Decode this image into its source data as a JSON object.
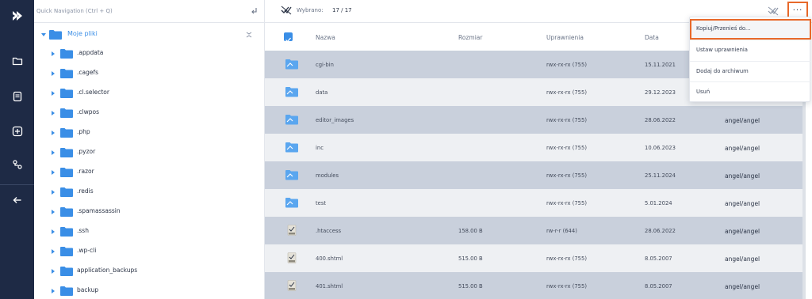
{
  "quick_nav": {
    "placeholder": "Quick Navigation (Ctrl + Q)"
  },
  "tree": {
    "root_label": "Moje pliki",
    "folders": [
      ".appdata",
      ".cagefs",
      ".cl.selector",
      ".clwpos",
      ".php",
      ".pyzor",
      ".razor",
      ".redis",
      ".spamassassin",
      ".ssh",
      ".wp-cli",
      "application_backups",
      "backup"
    ]
  },
  "selection": {
    "label": "Wybrano:",
    "count": "17 / 17"
  },
  "more_button": {
    "label": "···"
  },
  "columns": {
    "name": "Nazwa",
    "size": "Rozmiar",
    "permissions": "Uprawnienia",
    "date": "Data"
  },
  "files": [
    {
      "name": "cgi-bin",
      "type": "folder",
      "size": "",
      "permissions": "rwx-rx-rx (755)",
      "date": "15.11.2021",
      "owner": ""
    },
    {
      "name": "data",
      "type": "folder",
      "size": "",
      "permissions": "rwx-rx-rx (755)",
      "date": "29.12.2023",
      "owner": ""
    },
    {
      "name": "editor_images",
      "type": "folder",
      "size": "",
      "permissions": "rwx-rx-rx (755)",
      "date": "28.06.2022",
      "owner": "angel/angel"
    },
    {
      "name": "inc",
      "type": "folder",
      "size": "",
      "permissions": "rwx-rx-rx (755)",
      "date": "10.06.2023",
      "owner": "angel/angel"
    },
    {
      "name": "modules",
      "type": "folder",
      "size": "",
      "permissions": "rwx-rx-rx (755)",
      "date": "25.11.2024",
      "owner": "angel/angel"
    },
    {
      "name": "test",
      "type": "folder",
      "size": "",
      "permissions": "rwx-rx-rx (755)",
      "date": "5.01.2024",
      "owner": "angel/angel"
    },
    {
      "name": ".htaccess",
      "type": "file",
      "size": "158.00 B",
      "permissions": "rw-r-r (644)",
      "date": "28.06.2022",
      "owner": "angel/angel"
    },
    {
      "name": "400.shtml",
      "type": "file",
      "size": "515.00 B",
      "permissions": "rwx-rx-rx (755)",
      "date": "8.05.2007",
      "owner": "angel/angel"
    },
    {
      "name": "401.shtml",
      "type": "file",
      "size": "515.00 B",
      "permissions": "rwx-rx-rx (755)",
      "date": "8.05.2007",
      "owner": "angel/angel"
    }
  ],
  "menu": {
    "items": [
      "Kopiuj/Przenieś do...",
      "Ustaw uprawnienia",
      "Dodaj do archiwum",
      "Usuń"
    ]
  },
  "colors": {
    "rail": "#1e2a45",
    "accent": "#3a8ee6",
    "highlight": "#e8692a",
    "row_selected": "#c9d0dc"
  }
}
